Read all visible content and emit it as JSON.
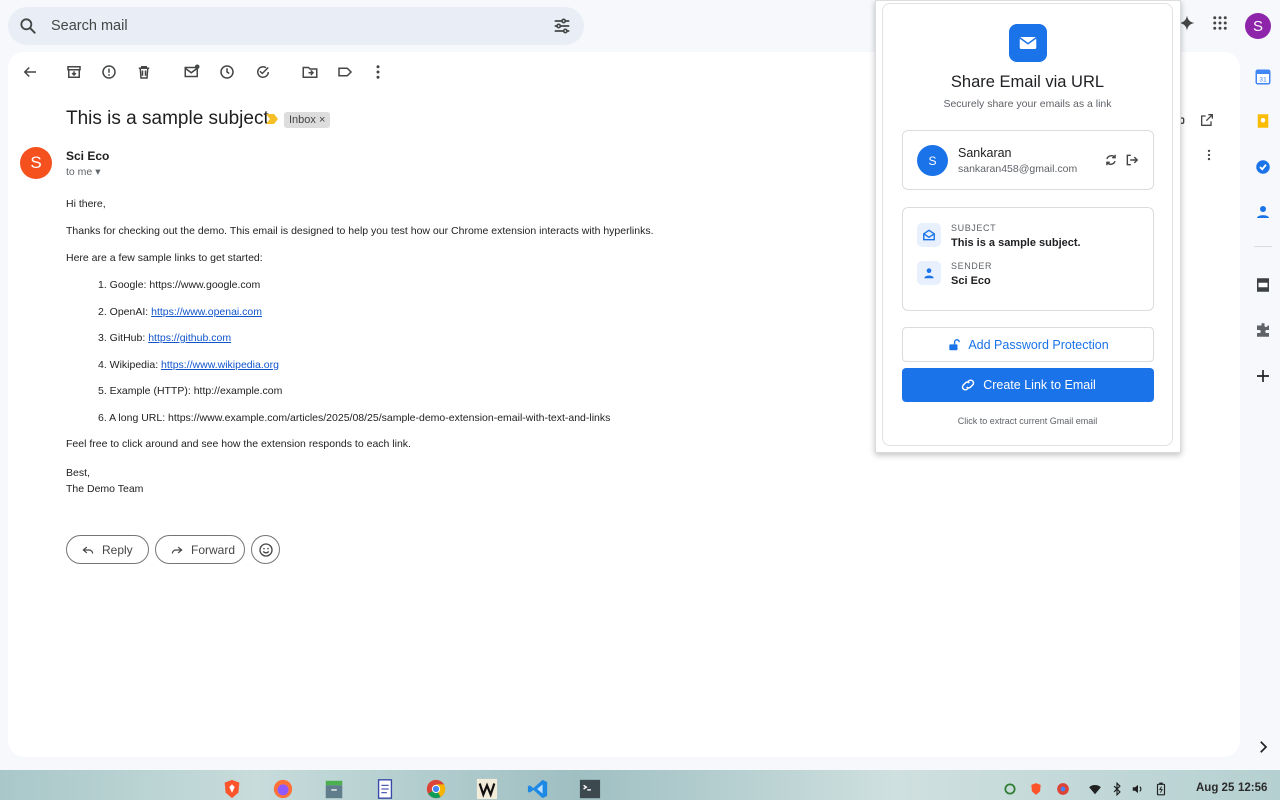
{
  "search": {
    "placeholder": "Search mail"
  },
  "account": {
    "initial": "S"
  },
  "email": {
    "subject": "This is a sample subject.",
    "label": "Inbox",
    "label_close": "×",
    "sender": "Sci Eco",
    "sender_initial": "S",
    "to": "to me",
    "greeting": "Hi there,",
    "para1": "Thanks for checking out the demo. This email is designed to help you test how our Chrome extension interacts with hyperlinks.",
    "para2": "Here are a few sample links to get started:",
    "links": [
      {
        "prefix": "1. Google: ",
        "text": "https://www.google.com",
        "linked": false
      },
      {
        "prefix": "2. OpenAI: ",
        "text": "https://www.openai.com",
        "linked": true
      },
      {
        "prefix": "3. GitHub: ",
        "text": "https://github.com",
        "linked": true
      },
      {
        "prefix": "4. Wikipedia: ",
        "text": "https://www.wikipedia.org",
        "linked": true
      },
      {
        "prefix": "5. Example (HTTP): ",
        "text": "http://example.com",
        "linked": false
      },
      {
        "prefix": "6. A long URL: ",
        "text": "https://www.example.com/articles/2025/08/25/sample-demo-extension-email-with-text-and-links",
        "linked": false
      }
    ],
    "para3": "Feel free to click around and see how the extension responds to each link.",
    "signoff": "Best,",
    "signature": "The Demo Team",
    "reply_label": "Reply",
    "forward_label": "Forward"
  },
  "popup": {
    "title": "Share Email via URL",
    "subtitle": "Securely share your emails as a link",
    "user_initial": "S",
    "user_name": "Sankaran",
    "user_email": "sankaran458@gmail.com",
    "subject_label": "SUBJECT",
    "subject_value": "This is a sample subject.",
    "sender_label": "SENDER",
    "sender_value": "Sci Eco",
    "password_button": "Add Password Protection",
    "create_button": "Create Link to Email",
    "hint": "Click to extract current Gmail email"
  },
  "taskbar": {
    "date": "Aug 25",
    "time": "12:56"
  },
  "colors": {
    "accent": "#1a73e8",
    "sender_avatar": "#f4511e",
    "account_avatar": "#8e24aa"
  }
}
